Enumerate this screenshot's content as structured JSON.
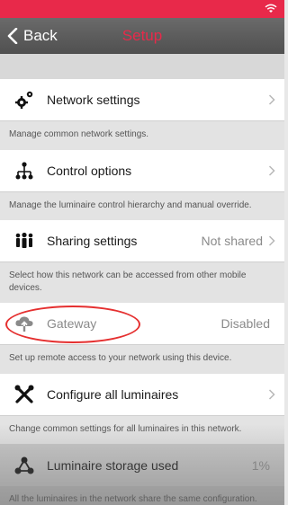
{
  "nav": {
    "back_label": "Back",
    "title": "Setup"
  },
  "rows": [
    {
      "label": "Network settings",
      "value": "",
      "icon": "gears-icon",
      "desc": "Manage common network settings."
    },
    {
      "label": "Control options",
      "value": "",
      "icon": "hierarchy-icon",
      "desc": "Manage the luminaire control hierarchy and manual override."
    },
    {
      "label": "Sharing settings",
      "value": "Not shared",
      "icon": "people-icon",
      "desc": "Select how this network can be accessed from other mobile devices."
    },
    {
      "label": "Gateway",
      "value": "Disabled",
      "icon": "cloud-upload-icon",
      "desc": "Set up remote access to your network using this device."
    },
    {
      "label": "Configure all luminaires",
      "value": "",
      "icon": "tools-icon",
      "desc": "Change common settings for all luminaires in this network."
    },
    {
      "label": "Luminaire storage used",
      "value": "1%",
      "icon": "network-icon",
      "desc": "All the luminaires in the network share the same configuration. Adding more luminaires, scenes and timers to"
    }
  ],
  "colors": {
    "accent": "#e8294a",
    "nav_bg": "#5a5a5a",
    "highlight_circle": "#e53030"
  }
}
